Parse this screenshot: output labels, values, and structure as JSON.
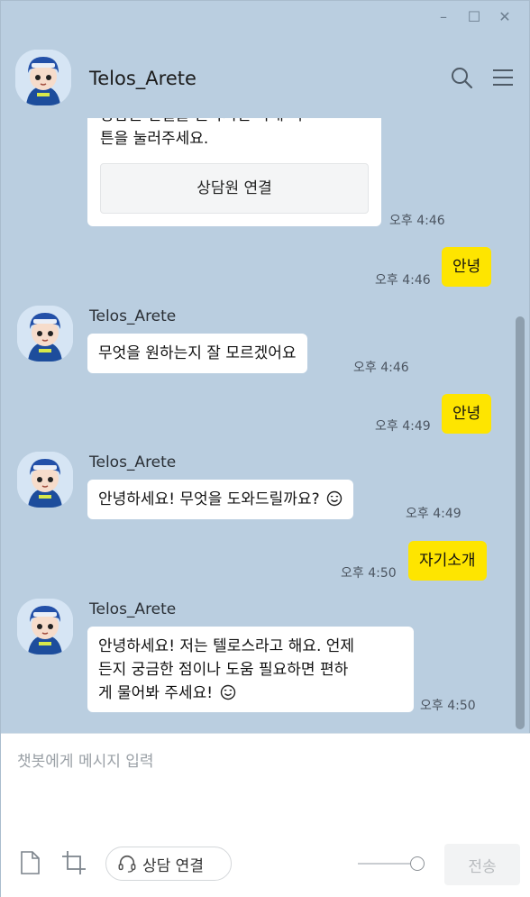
{
  "window": {
    "controls": [
      "–",
      "☐",
      "✕"
    ]
  },
  "header": {
    "title": "Telos_Arete",
    "icons": [
      "search-icon",
      "menu-icon"
    ]
  },
  "messages": [
    {
      "from": "bot",
      "type": "card",
      "text_lines": [
        "상담원 연결을 원하시면 아래 버",
        "튼을 눌러주세요."
      ],
      "button_label": "상담원 연결",
      "time": "오후 4:46"
    },
    {
      "from": "me",
      "text": "안녕",
      "time": "오후 4:46"
    },
    {
      "from": "bot",
      "sender": "Telos_Arete",
      "text": "무엇을 원하는지 잘 모르겠어요",
      "time": "오후 4:46"
    },
    {
      "from": "me",
      "text": "안녕",
      "time": "오후 4:49"
    },
    {
      "from": "bot",
      "sender": "Telos_Arete",
      "text": "안녕하세요! 무엇을 도와드릴까요?",
      "emoji": "smile-icon",
      "time": "오후 4:49"
    },
    {
      "from": "me",
      "text": "자기소개",
      "time": "오후 4:50"
    },
    {
      "from": "bot",
      "sender": "Telos_Arete",
      "text_lines": [
        "안녕하세요! 저는 텔로스라고 해요. 언제",
        "든지 궁금한 점이나 도움 필요하면 편하",
        "게 물어봐 주세요!"
      ],
      "emoji": "smile-icon",
      "time": "오후 4:50"
    }
  ],
  "input": {
    "placeholder": "챗봇에게 메시지 입력",
    "consult_button_label": "상담 연결",
    "send_label": "전송"
  },
  "colors": {
    "background": "#bacee0",
    "my_bubble": "#fee500",
    "bot_bubble": "#ffffff"
  }
}
